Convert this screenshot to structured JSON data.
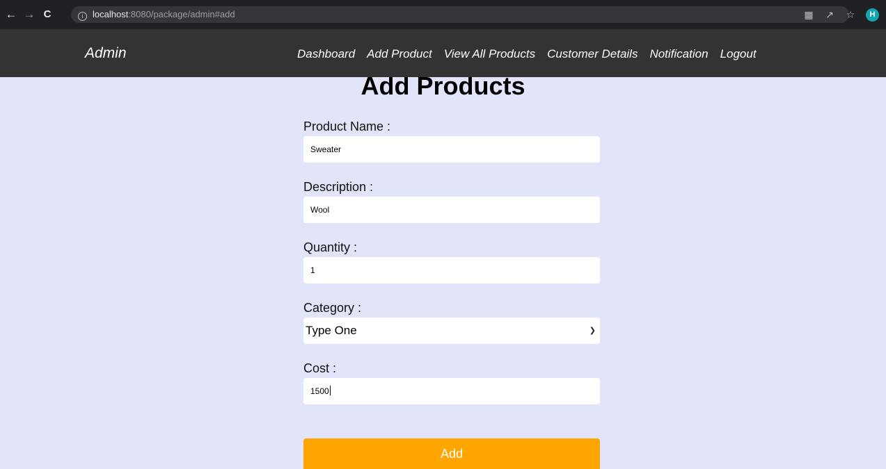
{
  "browser": {
    "url_host": "localhost",
    "url_rest": ":8080/package/admin#add",
    "avatar_initial": "H"
  },
  "nav": {
    "brand": "Admin",
    "links": [
      "Dashboard",
      "Add Product",
      "View All Products",
      "Customer Details",
      "Notification",
      "Logout"
    ]
  },
  "page": {
    "title": "Add Products"
  },
  "form": {
    "product_name": {
      "label": "Product Name :",
      "value": "Sweater"
    },
    "description": {
      "label": "Description :",
      "value": "Wool"
    },
    "quantity": {
      "label": "Quantity :",
      "value": "1"
    },
    "category": {
      "label": "Category :",
      "selected": "Type One"
    },
    "cost": {
      "label": "Cost :",
      "value": "1500"
    },
    "submit_label": "Add"
  },
  "colors": {
    "background": "#e2e4fa",
    "navbar": "#333333",
    "button": "#ffa500"
  }
}
